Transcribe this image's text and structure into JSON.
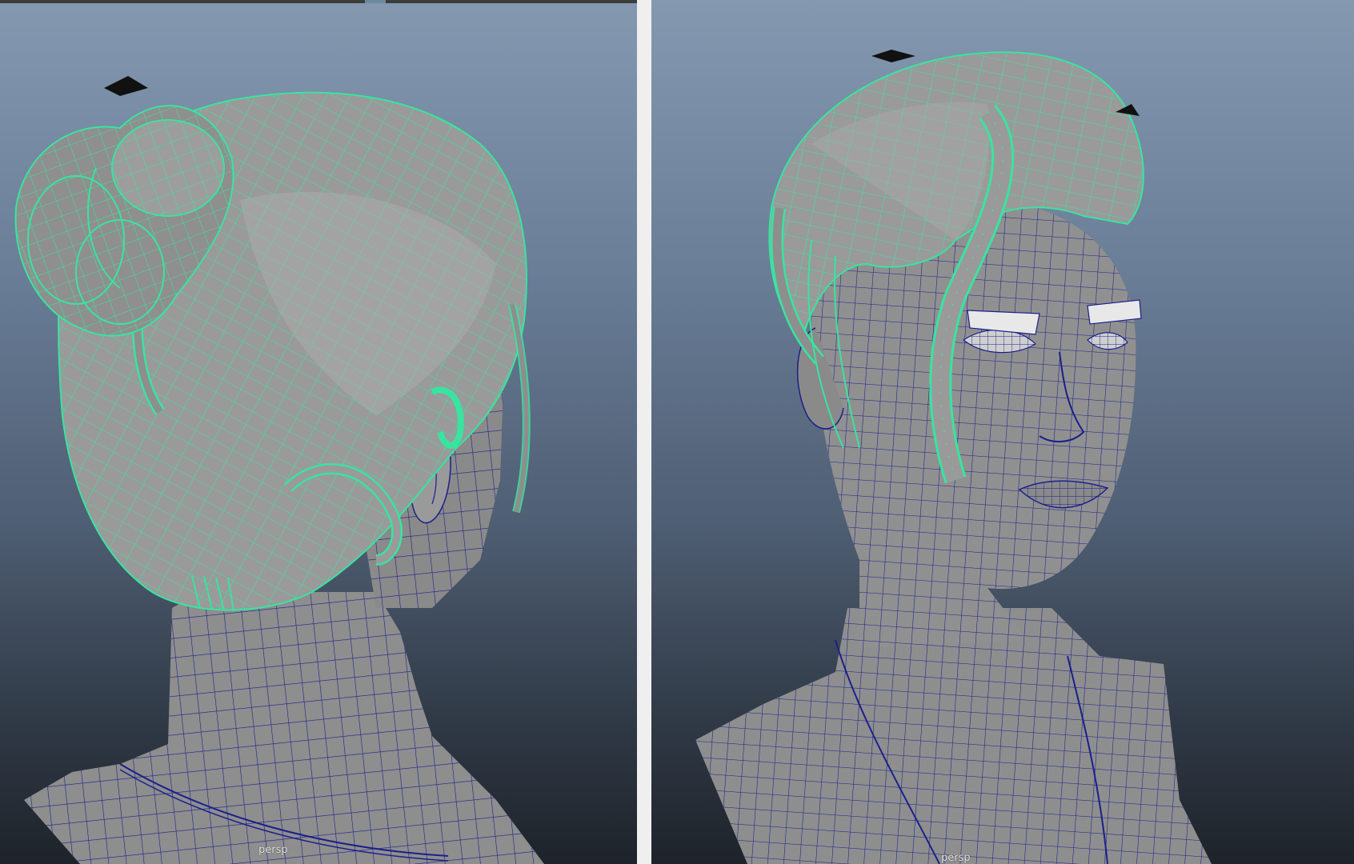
{
  "viewports": [
    {
      "id": "left",
      "camera_label": "persp"
    },
    {
      "id": "right",
      "camera_label": "persp"
    }
  ],
  "colors": {
    "hair_wire": "#39e4a0",
    "mesh_wire": "#1b1f8c",
    "mesh_fill": "#8e8e8e",
    "hair_fill": "#9a9a9a",
    "bg_top": "#8498b0",
    "bg_bottom": "#1e232a"
  }
}
